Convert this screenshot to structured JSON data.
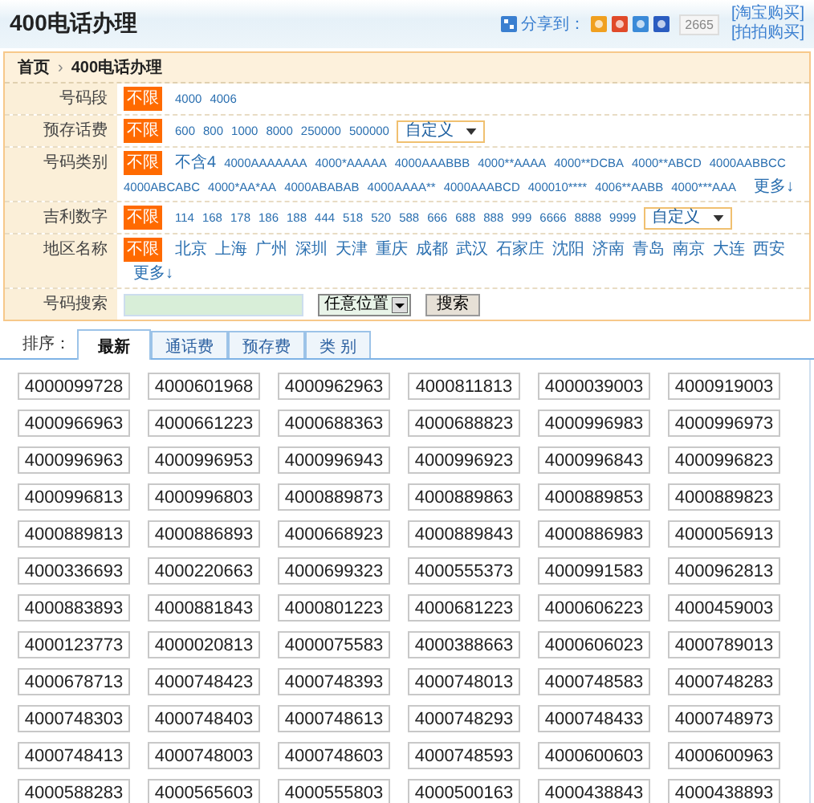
{
  "header": {
    "title": "400电话办理",
    "share_label": "分享到：",
    "share_count": "2665",
    "links": [
      "[淘宝购买]",
      "[拍拍购买]"
    ]
  },
  "breadcrumb": {
    "separator": "›",
    "items": [
      "首页",
      "400电话办理"
    ]
  },
  "filters": [
    {
      "kind": "options",
      "label": "号码段",
      "unlimited": {
        "label": "不限",
        "selected": true
      },
      "options": [
        "4000",
        "4006"
      ]
    },
    {
      "kind": "options",
      "label": "预存话费",
      "unlimited": {
        "label": "不限",
        "selected": true
      },
      "options": [
        "600",
        "800",
        "1000",
        "8000",
        "250000",
        "500000"
      ],
      "dropdown": "自定义"
    },
    {
      "kind": "options",
      "label": "号码类别",
      "unlimited": {
        "label": "不限",
        "selected": true
      },
      "options": [
        "不含4",
        "4000AAAAAAA",
        "4000*AAAAA",
        "4000AAABBB",
        "4000**AAAA",
        "4000**DCBA",
        "4000**ABCD",
        "4000AABBCC",
        "4000ABCABC",
        "4000*AA*AA",
        "4000ABABAB",
        "4000AAAA**",
        "4000AAABCD",
        "400010****",
        "4006**AABB",
        "4000***AAA"
      ],
      "more": "更多↓"
    },
    {
      "kind": "options",
      "label": "吉利数字",
      "unlimited": {
        "label": "不限",
        "selected": true
      },
      "options": [
        "114",
        "168",
        "178",
        "186",
        "188",
        "444",
        "518",
        "520",
        "588",
        "666",
        "688",
        "888",
        "999",
        "6666",
        "8888",
        "9999"
      ],
      "dropdown": "自定义"
    },
    {
      "kind": "options",
      "label": "地区名称",
      "unlimited": {
        "label": "不限",
        "selected": true
      },
      "options": [
        "北京",
        "上海",
        "广州",
        "深圳",
        "天津",
        "重庆",
        "成都",
        "武汉",
        "石家庄",
        "沈阳",
        "济南",
        "青岛",
        "南京",
        "大连",
        "西安"
      ],
      "more": "更多↓"
    },
    {
      "kind": "search",
      "label": "号码搜索",
      "select": "任意位置",
      "button": "搜索"
    }
  ],
  "sort": {
    "label": "排序：",
    "tabs": [
      {
        "label": "最新",
        "selected": true
      },
      {
        "label": "通话费",
        "selected": false
      },
      {
        "label": "预存费",
        "selected": false
      },
      {
        "label": "类 别",
        "selected": false
      }
    ]
  },
  "numbers": [
    "4000099728",
    "4000601968",
    "4000962963",
    "4000811813",
    "4000039003",
    "4000919003",
    "4000966963",
    "4000661223",
    "4000688363",
    "4000688823",
    "4000996983",
    "4000996973",
    "4000996963",
    "4000996953",
    "4000996943",
    "4000996923",
    "4000996843",
    "4000996823",
    "4000996813",
    "4000996803",
    "4000889873",
    "4000889863",
    "4000889853",
    "4000889823",
    "4000889813",
    "4000886893",
    "4000668923",
    "4000889843",
    "4000886983",
    "4000056913",
    "4000336693",
    "4000220663",
    "4000699323",
    "4000555373",
    "4000991583",
    "4000962813",
    "4000883893",
    "4000881843",
    "4000801223",
    "4000681223",
    "4000606223",
    "4000459003",
    "4000123773",
    "4000020813",
    "4000075583",
    "4000388663",
    "4000606023",
    "4000789013",
    "4000678713",
    "4000748423",
    "4000748393",
    "4000748013",
    "4000748583",
    "4000748283",
    "4000748303",
    "4000748403",
    "4000748613",
    "4000748293",
    "4000748433",
    "4000748973",
    "4000748413",
    "4000748003",
    "4000748603",
    "4000748593",
    "4000600603",
    "4000600963",
    "4000588283",
    "4000565603",
    "4000555803",
    "4000500163",
    "4000438843",
    "4000438893"
  ]
}
